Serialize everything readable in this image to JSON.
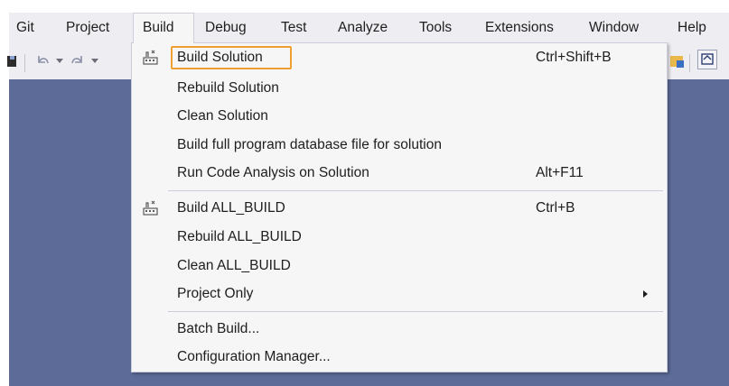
{
  "menubar": {
    "items": [
      {
        "label": "Git"
      },
      {
        "label": "Project"
      },
      {
        "label": "Build"
      },
      {
        "label": "Debug"
      },
      {
        "label": "Test"
      },
      {
        "label": "Analyze"
      },
      {
        "label": "Tools"
      },
      {
        "label": "Extensions"
      },
      {
        "label": "Window"
      },
      {
        "label": "Help"
      }
    ],
    "open_menu": "Build"
  },
  "build_menu": {
    "items": [
      {
        "label": "Build Solution",
        "shortcut": "Ctrl+Shift+B",
        "icon": "build-icon",
        "highlighted": true
      },
      {
        "label": "Rebuild Solution",
        "shortcut": ""
      },
      {
        "label": "Clean Solution",
        "shortcut": ""
      },
      {
        "label": "Build full program database file for solution",
        "shortcut": ""
      },
      {
        "label": "Run Code Analysis on Solution",
        "shortcut": "Alt+F11"
      },
      {
        "label": "Build ALL_BUILD",
        "shortcut": "Ctrl+B",
        "icon": "build-icon"
      },
      {
        "label": "Rebuild ALL_BUILD",
        "shortcut": ""
      },
      {
        "label": "Clean ALL_BUILD",
        "shortcut": ""
      },
      {
        "label": "Project Only",
        "shortcut": "",
        "submenu": true
      },
      {
        "label": "Batch Build...",
        "shortcut": ""
      },
      {
        "label": "Configuration Manager...",
        "shortcut": ""
      }
    ]
  },
  "colors": {
    "menubar_bg": "#eeeef2",
    "workspace_bg": "#5d6b99",
    "menu_bg": "#f6f6f6",
    "highlight_border": "#f0a030"
  },
  "toolbar": {
    "icons": [
      "save-icon",
      "undo-icon",
      "redo-icon",
      "find-icon",
      "window-icon"
    ]
  }
}
